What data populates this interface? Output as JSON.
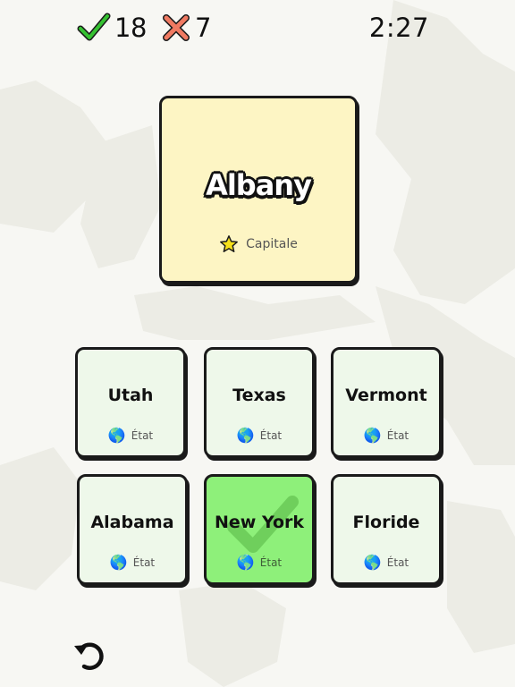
{
  "header": {
    "correct_count": "18",
    "wrong_count": "7",
    "timer": "2:27",
    "correct_color": "#36c232",
    "wrong_color": "#f07a62"
  },
  "question": {
    "title": "Albany",
    "subtitle": "Capitale",
    "icon": "star-icon",
    "background": "#fdf5c4"
  },
  "answers": [
    {
      "name": "Utah",
      "type": "État",
      "icon": "globe-icon",
      "state": "default"
    },
    {
      "name": "Texas",
      "type": "État",
      "icon": "globe-icon",
      "state": "default"
    },
    {
      "name": "Vermont",
      "type": "État",
      "icon": "globe-icon",
      "state": "default"
    },
    {
      "name": "Alabama",
      "type": "État",
      "icon": "globe-icon",
      "state": "default"
    },
    {
      "name": "New York",
      "type": "État",
      "icon": "globe-icon",
      "state": "correct"
    },
    {
      "name": "Floride",
      "type": "État",
      "icon": "globe-icon",
      "state": "default"
    }
  ],
  "colors": {
    "answer_default": "#eef8ea",
    "answer_correct": "#8ef07a"
  },
  "footer": {
    "undo_icon": "undo-icon"
  }
}
